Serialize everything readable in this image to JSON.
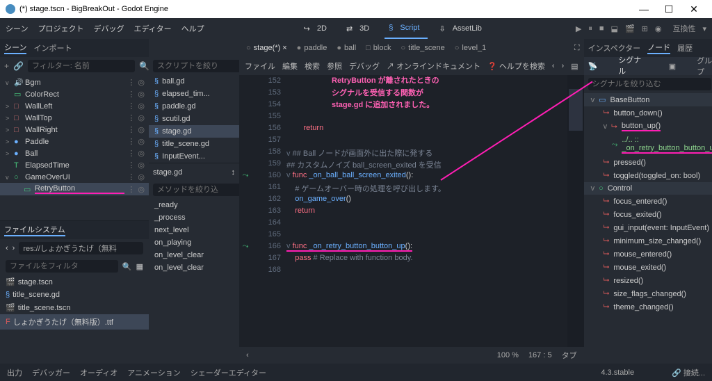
{
  "title": "(*) stage.tscn - BigBreakOut - Godot Engine",
  "menu": {
    "scene": "シーン",
    "project": "プロジェクト",
    "debug": "デバッグ",
    "editor": "エディター",
    "help": "ヘルプ"
  },
  "workspaces": {
    "d2": "2D",
    "d3": "3D",
    "script": "Script",
    "assetlib": "AssetLib"
  },
  "compat": "互換性",
  "scene_dock": {
    "tab_scene": "シーン",
    "tab_import": "インポート",
    "filter_placeholder": "フィルター: 名前",
    "nodes": [
      {
        "indent": 0,
        "toggle": "v",
        "icon": "🔊",
        "label": "Bgm",
        "iconcolor": "#bbb"
      },
      {
        "indent": 0,
        "toggle": "",
        "icon": "▭",
        "label": "ColorRect",
        "iconcolor": "#46c37b"
      },
      {
        "indent": 0,
        "toggle": ">",
        "icon": "□",
        "label": "WallLeft",
        "iconcolor": "#c96f6f"
      },
      {
        "indent": 0,
        "toggle": ">",
        "icon": "□",
        "label": "WallTop",
        "iconcolor": "#c96f6f"
      },
      {
        "indent": 0,
        "toggle": ">",
        "icon": "□",
        "label": "WallRight",
        "iconcolor": "#c96f6f"
      },
      {
        "indent": 0,
        "toggle": ">",
        "icon": "●",
        "label": "Paddle",
        "iconcolor": "#6bb0ff"
      },
      {
        "indent": 0,
        "toggle": ">",
        "icon": "●",
        "label": "Ball",
        "iconcolor": "#6bb0ff"
      },
      {
        "indent": 0,
        "toggle": "",
        "icon": "T",
        "label": "ElapsedTime",
        "iconcolor": "#46c37b"
      },
      {
        "indent": 0,
        "toggle": "v",
        "icon": "○",
        "label": "GameOverUI",
        "iconcolor": "#46c37b"
      },
      {
        "indent": 1,
        "toggle": "",
        "icon": "▭",
        "label": "RetryButton",
        "sel": true,
        "iconcolor": "#46c37b",
        "underline": true
      }
    ]
  },
  "fs": {
    "title": "ファイルシステム",
    "path": "res://しょかぎうたげ（無料",
    "filter_placeholder": "ファイルをフィルタ",
    "items": [
      {
        "icon": "🎬",
        "label": "stage.tscn",
        "iconcolor": "#6bb0ff"
      },
      {
        "icon": "§",
        "label": "title_scene.gd",
        "iconcolor": "#6bb0ff"
      },
      {
        "icon": "🎬",
        "label": "title_scene.tscn",
        "iconcolor": "#6bb0ff"
      },
      {
        "icon": "F",
        "label": "しょかぎうたげ（無料版）.ttf",
        "sel": true,
        "iconcolor": "#d65a5a"
      }
    ]
  },
  "scripts": {
    "filter": "スクリプトを絞り",
    "items": [
      {
        "label": "ball.gd"
      },
      {
        "label": "elapsed_tim..."
      },
      {
        "label": "paddle.gd"
      },
      {
        "label": "scutil.gd"
      },
      {
        "label": "stage.gd",
        "sel": true
      },
      {
        "label": "title_scene.gd"
      },
      {
        "label": "InputEvent..."
      }
    ],
    "current": "stage.gd",
    "method_filter": "メソッドを絞り込",
    "methods": [
      "_ready",
      "_process",
      "next_level",
      "on_playing",
      "on_level_clear",
      "on_level_clear"
    ]
  },
  "code_tabs": [
    {
      "label": "stage(*)",
      "active": true,
      "icon": "○"
    },
    {
      "label": "paddle",
      "icon": "●"
    },
    {
      "label": "ball",
      "icon": "●"
    },
    {
      "label": "block",
      "icon": "□"
    },
    {
      "label": "title_scene",
      "icon": "○"
    },
    {
      "label": "level_1",
      "icon": "○"
    }
  ],
  "code_menu": {
    "file": "ファイル",
    "edit": "編集",
    "search": "検索",
    "ref": "参照",
    "debug": "デバッグ",
    "online": "オンラインドキュメント",
    "helpsearch": "ヘルプを検索"
  },
  "callout": {
    "l1": "RetryButton が離されたときの",
    "l2": "シグナルを受信する関数が",
    "l3": "stage.gd に追加されました。"
  },
  "code": {
    "start": 152,
    "lines": [
      {
        "n": 152,
        "t": ""
      },
      {
        "n": 153,
        "t": ""
      },
      {
        "n": 154,
        "t": ""
      },
      {
        "n": 155,
        "t": ""
      },
      {
        "n": 156,
        "t": "        <kw>return</kw>"
      },
      {
        "n": 157,
        "t": ""
      },
      {
        "n": 158,
        "t": "<cm>## Ball ノードが画面外に出た際に発する</cm>",
        "fold": "v"
      },
      {
        "n": 159,
        "t": "<cm>## カスタムノイズ ball_screen_exited を受信</cm>"
      },
      {
        "n": 160,
        "t": "<kw>func</kw> <fn>_on_ball_ball_screen_exited</fn>():",
        "fold": "v",
        "sig": true
      },
      {
        "n": 161,
        "t": "    <cm># ゲームオーバー時の処理を呼び出します。</cm>"
      },
      {
        "n": 162,
        "t": "    <fn>on_game_over</fn>()"
      },
      {
        "n": 163,
        "t": "    <kw>return</kw>"
      },
      {
        "n": 164,
        "t": ""
      },
      {
        "n": 165,
        "t": ""
      },
      {
        "n": 166,
        "t": "<kw>func</kw> <fn>_on_retry_button_button_up</fn>():",
        "fold": "v",
        "sig": true,
        "underline": true
      },
      {
        "n": 167,
        "t": "    <kw>pass</kw> <cm># Replace with function body.</cm>"
      },
      {
        "n": 168,
        "t": ""
      }
    ]
  },
  "status": {
    "zoom": "100 %",
    "pos": "167 :     5",
    "tab": "タブ"
  },
  "bottom": {
    "output": "出力",
    "debugger": "デバッガー",
    "audio": "オーディオ",
    "anim": "アニメーション",
    "shader": "シェーダーエディター",
    "version": "4.3.stable",
    "connect": "接続..."
  },
  "inspector": {
    "tab_inspector": "インスペクター",
    "tab_node": "ノード",
    "tab_history": "履歴",
    "tab_signal": "シグナル",
    "tab_group": "グループ",
    "filter": "シグナルを絞り込む",
    "items": [
      {
        "type": "class",
        "toggle": "v",
        "label": "BaseButton"
      },
      {
        "type": "sig",
        "label": "button_down()"
      },
      {
        "type": "sig",
        "label": "button_up()",
        "toggle": "v",
        "underline": true
      },
      {
        "type": "con",
        "label": "../.. :: _on_retry_button_button_up()",
        "underline": true
      },
      {
        "type": "sig",
        "label": "pressed()"
      },
      {
        "type": "sig",
        "label": "toggled(toggled_on: bool)"
      },
      {
        "type": "class",
        "toggle": "v",
        "label": "Control",
        "circle": true
      },
      {
        "type": "sig",
        "label": "focus_entered()"
      },
      {
        "type": "sig",
        "label": "focus_exited()"
      },
      {
        "type": "sig",
        "label": "gui_input(event: InputEvent)"
      },
      {
        "type": "sig",
        "label": "minimum_size_changed()"
      },
      {
        "type": "sig",
        "label": "mouse_entered()"
      },
      {
        "type": "sig",
        "label": "mouse_exited()"
      },
      {
        "type": "sig",
        "label": "resized()"
      },
      {
        "type": "sig",
        "label": "size_flags_changed()"
      },
      {
        "type": "sig",
        "label": "theme_changed()"
      }
    ]
  }
}
